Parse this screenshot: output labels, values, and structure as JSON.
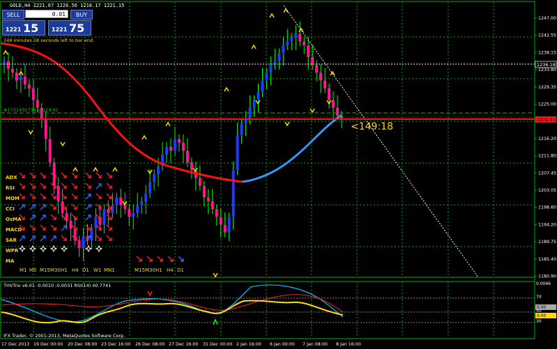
{
  "window": {
    "symbol_header": "GOLD,H4  1221.67 1226.56 1218.17 1221.15"
  },
  "trade_panel": {
    "sell_label": "SELL",
    "buy_label": "BUY",
    "lot": "0.01",
    "bid_small": "1221",
    "bid_big": "15",
    "ask_small": "1221",
    "ask_big": "75"
  },
  "timer_text": "149 minutes 18 seconds left to bar end",
  "order_label": "#1731431734 sl 110.01",
  "countdown": "<149:18",
  "price_axis": [
    "1247.00",
    "1242.55",
    "1238.15",
    "1233.80",
    "1229.35",
    "1225.00",
    "1220.55",
    "1216.20",
    "1211.80",
    "1207.45",
    "1203.05",
    "1198.60",
    "1194.20",
    "1189.75",
    "1185.40",
    "1180.90"
  ],
  "price_tags": {
    "top": "1230.20",
    "hline": "1236.18",
    "current": "1221.15"
  },
  "time_axis": [
    "17 Dec 2013",
    "19 Dec 00:00",
    "20 Dec 08:00",
    "23 Dec 16:00",
    "26 Dec 08:00",
    "27 Dec 16:00",
    "31 Dec 00:00",
    "2 Jan 16:00",
    "6 Jan 00:00",
    "7 Jan 08:00",
    "8 Jan 16:00"
  ],
  "indicator_matrix": {
    "rows": [
      "ADX",
      "RSI",
      "MOM",
      "CCI",
      "OsMA",
      "MACD",
      "SAR",
      "WPR",
      "MA"
    ],
    "timeframes_left": [
      "M1",
      "M5",
      "M15",
      "M30",
      "H1",
      "H4",
      "D1",
      "W1",
      "MN1"
    ],
    "timeframes_right": [
      "M15",
      "M30",
      "H1",
      "H4",
      "D1"
    ]
  },
  "subwindow": {
    "label": "THVTrix v6.01 -0.0010 -0.0031  RSI(14) 40.7741",
    "axis": [
      "0.0046",
      "70",
      "50",
      "30"
    ],
    "tags": [
      "0.00",
      "0.00"
    ]
  },
  "footer": "IFX Trader, © 2001-2013, MetaQuotes Software Corp.",
  "colors": {
    "bull": "#1e3cff",
    "bear": "#ff1493",
    "ma_red": "#ff1010",
    "ma_blue": "#3399ff",
    "grid": "#00b000",
    "arrow": "#ffd700"
  },
  "chart_data": {
    "type": "candlestick",
    "price_range": [
      1180.9,
      1247.0
    ],
    "ma_line": "red/blue moving average",
    "candles_hint": "bearish decline to 1185 then bullish rally to 1247 then pullback to 1221"
  }
}
